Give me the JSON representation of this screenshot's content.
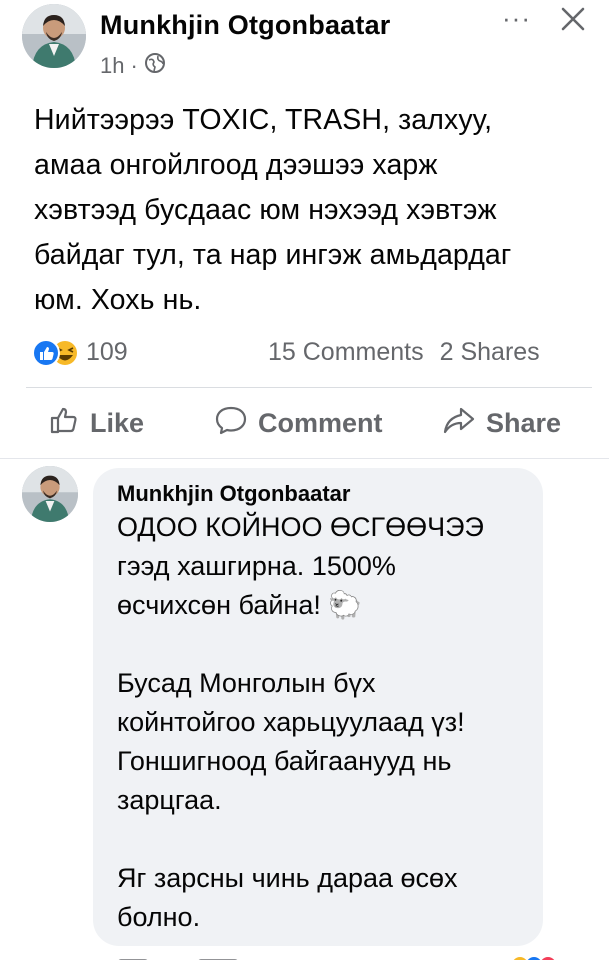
{
  "post": {
    "author": "Munkhjin Otgonbaatar",
    "time": "1h",
    "separator": "·",
    "body": "Нийтээрээ TOXIC, TRASH, залхуу,\nамаа онгойлгоод дээшээ харж\nхэвтээд бусдаас юм нэхээд хэвтэж\nбайдаг тул, та нар ингэж амьдардаг\nюм. Хохь нь.",
    "reaction_count": "109",
    "comments_label": "15 Comments",
    "shares_label": "2 Shares"
  },
  "header": {
    "more_label": "···"
  },
  "actions": {
    "like": "Like",
    "comment": "Comment",
    "share": "Share"
  },
  "comment": {
    "author": "Munkhjin Otgonbaatar",
    "body": "ОДОО КОЙНОО ӨСГӨӨЧЭЭ\nгээд хашгирна. 1500%\nөсчихсөн байна! 🐑\n\nБусад Монголын бүх\nкойнтойгоо харьцуулаад үз!\nГоншигноод байгаанууд нь\nзарцгаа.\n\nЯг зарсны чинь дараа өсөх\nболно."
  },
  "colors": {
    "like_blue": "#1877f2",
    "haha_yellow": "#f7b928",
    "secondary_text": "#65676b",
    "bubble_bg": "#f0f2f5"
  },
  "icons": [
    "globe-icon",
    "more-icon",
    "close-icon",
    "like-reaction-icon",
    "haha-reaction-icon",
    "thumbs-up-icon",
    "comment-icon",
    "share-icon",
    "sheep-emoji-icon"
  ]
}
